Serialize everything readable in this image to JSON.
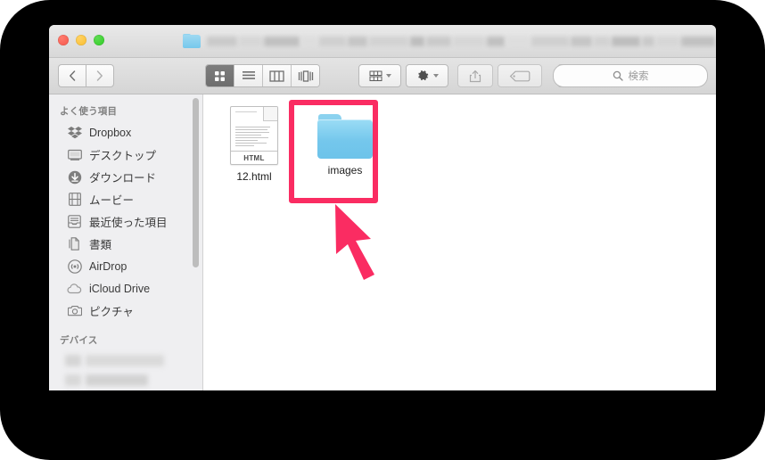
{
  "window": {
    "title_is_redacted": true,
    "title_icon": "folder-icon"
  },
  "traffic_lights": {
    "close_label": "Close",
    "minimize_label": "Minimize",
    "maximize_label": "Zoom"
  },
  "toolbar": {
    "back_label": "‹",
    "forward_label": "›",
    "view_modes": [
      {
        "name": "icon-view",
        "active": true
      },
      {
        "name": "list-view",
        "active": false
      },
      {
        "name": "column-view",
        "active": false
      },
      {
        "name": "coverflow-view",
        "active": false
      }
    ],
    "arrange_label": "",
    "action_label": "",
    "share_label": "",
    "tag_label": "",
    "dropbox_label": ""
  },
  "search": {
    "placeholder": "検索",
    "value": ""
  },
  "sidebar": {
    "sections": [
      {
        "header": "よく使う項目",
        "items": [
          {
            "label": "Dropbox",
            "icon": "dropbox-icon"
          },
          {
            "label": "デスクトップ",
            "icon": "desktop-icon"
          },
          {
            "label": "ダウンロード",
            "icon": "downloads-icon"
          },
          {
            "label": "ムービー",
            "icon": "movies-icon"
          },
          {
            "label": "最近使った項目",
            "icon": "recents-icon"
          },
          {
            "label": "書類",
            "icon": "documents-icon"
          },
          {
            "label": "AirDrop",
            "icon": "airdrop-icon"
          },
          {
            "label": "iCloud Drive",
            "icon": "icloud-icon"
          },
          {
            "label": "ピクチャ",
            "icon": "pictures-icon"
          }
        ]
      },
      {
        "header": "デバイス",
        "items_redacted": true,
        "redacted_row_count": 3
      }
    ]
  },
  "content": {
    "items": [
      {
        "name": "12.html",
        "kind": "html-document",
        "badge": "HTML",
        "highlighted": false
      },
      {
        "name": "images",
        "kind": "folder",
        "badge": "",
        "highlighted": true
      }
    ]
  },
  "annotations": {
    "highlight_color": "#fa2c62",
    "arrow_color": "#fa2c62",
    "arrow_points_to": "images",
    "highlight_target": "images"
  },
  "colors": {
    "bezel": "#000000",
    "titlebar_top": "#e9e9e9",
    "titlebar_bottom": "#d8d8d8",
    "toolbar_top": "#e4e4e4",
    "toolbar_bottom": "#d5d5d5",
    "sidebar_bg": "#efeff1",
    "content_bg": "#ffffff",
    "folder_blue": "#74c7ec",
    "accent_pink": "#fa2c62"
  }
}
